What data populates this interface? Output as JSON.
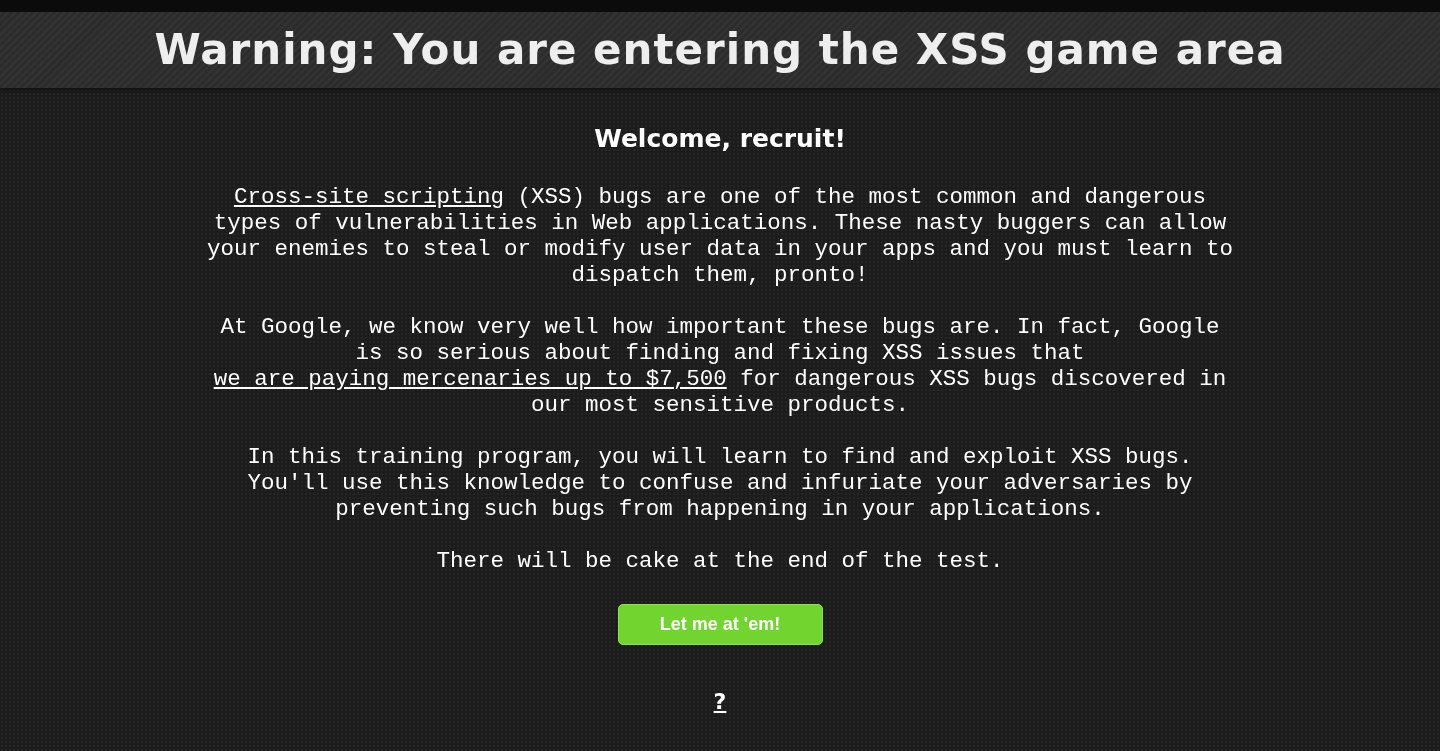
{
  "header": {
    "title": "Warning: You are entering the XSS game area"
  },
  "main": {
    "heading": "Welcome, recruit!",
    "paragraphs": [
      [
        {
          "kind": "link",
          "text": "Cross-site scripting"
        },
        {
          "kind": "text",
          "text": " (XSS) bugs are one of the most common and dangerous types of vulnerabilities in Web applications. These nasty buggers can allow your enemies to steal or modify user data in your apps and you must learn to dispatch them, pronto!"
        }
      ],
      [
        {
          "kind": "text",
          "text": "At Google, we know very well how important these bugs are. In fact, Google is so serious about finding and fixing XSS issues that "
        },
        {
          "kind": "link",
          "text": "we are paying mercenaries up to $7,500"
        },
        {
          "kind": "text",
          "text": " for dangerous XSS bugs discovered in our most sensitive products."
        }
      ],
      [
        {
          "kind": "text",
          "text": "In this training program, you will learn to find and exploit XSS bugs. You'll use this knowledge to confuse and infuriate your adversaries by preventing such bugs from happening in your applications."
        }
      ],
      [
        {
          "kind": "text",
          "text": "There will be cake at the end of the test."
        }
      ]
    ],
    "button": "Let me at 'em!",
    "help_link": "?"
  }
}
